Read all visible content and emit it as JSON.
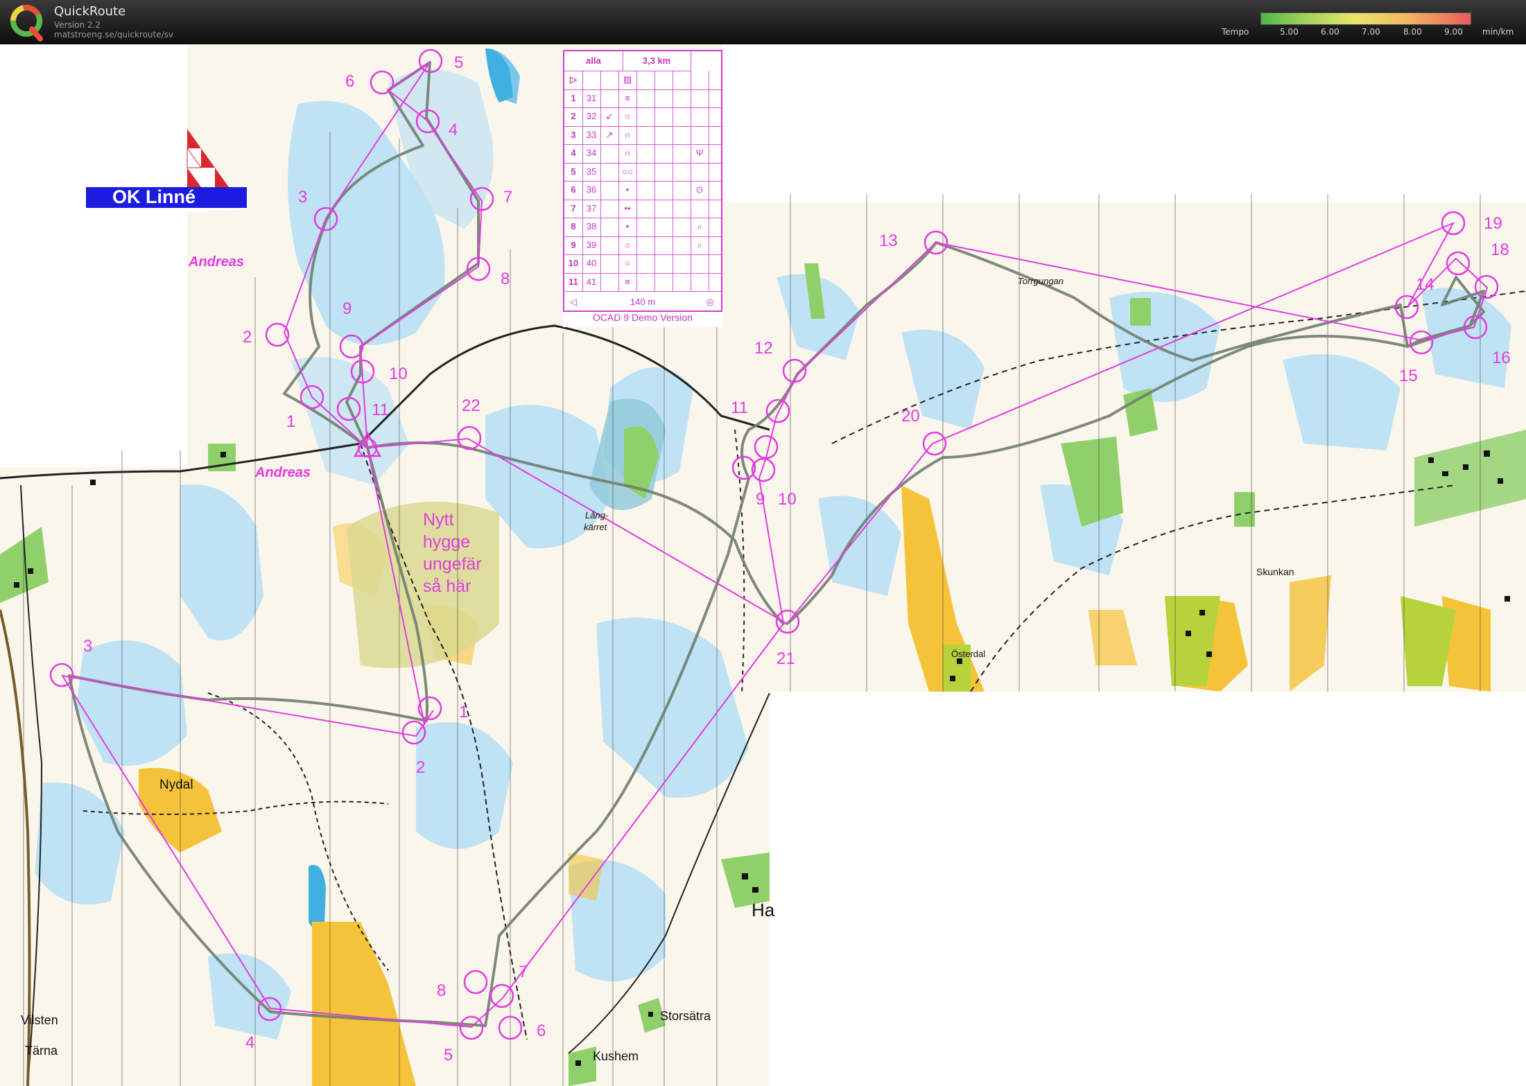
{
  "app": {
    "title": "QuickRoute",
    "version": "Version 2.2",
    "url": "matstroeng.se/quickroute/sv"
  },
  "tempo_legend": {
    "label": "Tempo",
    "ticks": [
      "5.00",
      "6.00",
      "7.00",
      "8.00",
      "9.00"
    ],
    "unit": "min/km",
    "colors": [
      "#4fb64a",
      "#9fd25a",
      "#e9e66a",
      "#f2b661",
      "#ec5b5b"
    ]
  },
  "club": {
    "name": "OK Linné",
    "runner_labels": [
      "Andreas",
      "Andreas"
    ]
  },
  "control_description": {
    "category": "alla",
    "distance": "3,3 km",
    "rows": [
      {
        "num": "1",
        "code": "31",
        "feature": "≡"
      },
      {
        "num": "2",
        "code": "32",
        "feature": "○",
        "direction": "↙"
      },
      {
        "num": "3",
        "code": "33",
        "feature": "∩",
        "direction": "↗"
      },
      {
        "num": "4",
        "code": "34",
        "feature": "∩",
        "extra": "Ψ"
      },
      {
        "num": "5",
        "code": "35",
        "feature": "○○"
      },
      {
        "num": "6",
        "code": "36",
        "feature": "•",
        "extra": "⊙"
      },
      {
        "num": "7",
        "code": "37",
        "feature": "••"
      },
      {
        "num": "8",
        "code": "38",
        "feature": "•",
        "extra": "⌕"
      },
      {
        "num": "9",
        "code": "39",
        "feature": "○",
        "extra": "⌕"
      },
      {
        "num": "10",
        "code": "40",
        "feature": "○"
      },
      {
        "num": "11",
        "code": "41",
        "feature": "≡"
      }
    ],
    "finish_distance": "140 m",
    "demo_note": "OCAD 9 Demo Version"
  },
  "map_labels": {
    "place_names": [
      "Nydal",
      "Vilsten",
      "Tärna",
      "Kushem",
      "Storsätra",
      "Österdal",
      "Skunkan",
      "Torrgungan",
      "Lång-",
      "kärret",
      "Ha"
    ],
    "note": [
      "Nytt",
      "hygge",
      "ungefär",
      "så här"
    ]
  },
  "course_colors": {
    "course": "#e23be2",
    "route": "#6f7e6f",
    "water": "#bfe3f5",
    "open": "#f5c33a",
    "green": "#8fd06a"
  },
  "course_a_labels": [
    "1",
    "2",
    "3",
    "4",
    "5",
    "6",
    "7",
    "8",
    "9",
    "10",
    "11",
    "22"
  ],
  "course_b_labels": [
    "1",
    "2",
    "3",
    "4",
    "5",
    "6",
    "7",
    "8"
  ],
  "course_c_labels": [
    "9",
    "10",
    "11",
    "12",
    "13",
    "14",
    "15",
    "16",
    "18",
    "19",
    "20",
    "21"
  ]
}
